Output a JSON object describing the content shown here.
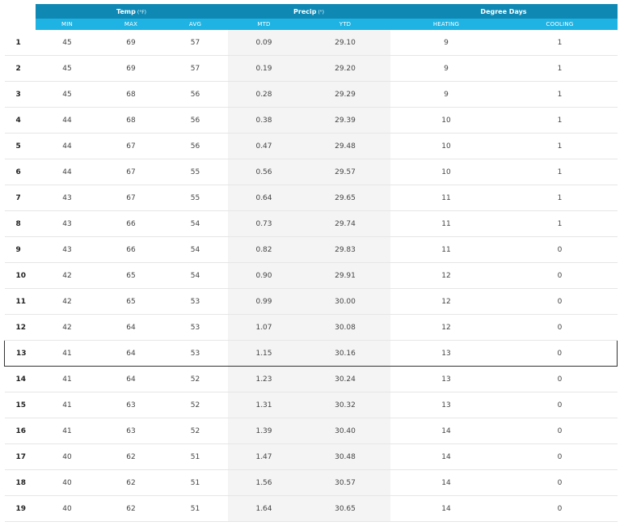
{
  "header": {
    "groups": [
      {
        "label": "Temp",
        "unit": "(°F)"
      },
      {
        "label": "Precip",
        "unit": "(\")"
      },
      {
        "label": "Degree Days",
        "unit": ""
      }
    ],
    "columns": [
      "MIN",
      "MAX",
      "AVG",
      "MTD",
      "YTD",
      "HEATING",
      "COOLING"
    ]
  },
  "selected_day": "13",
  "rows": [
    {
      "day": "1",
      "min": "45",
      "max": "69",
      "avg": "57",
      "mtd": "0.09",
      "ytd": "29.10",
      "heating": "9",
      "cooling": "1"
    },
    {
      "day": "2",
      "min": "45",
      "max": "69",
      "avg": "57",
      "mtd": "0.19",
      "ytd": "29.20",
      "heating": "9",
      "cooling": "1"
    },
    {
      "day": "3",
      "min": "45",
      "max": "68",
      "avg": "56",
      "mtd": "0.28",
      "ytd": "29.29",
      "heating": "9",
      "cooling": "1"
    },
    {
      "day": "4",
      "min": "44",
      "max": "68",
      "avg": "56",
      "mtd": "0.38",
      "ytd": "29.39",
      "heating": "10",
      "cooling": "1"
    },
    {
      "day": "5",
      "min": "44",
      "max": "67",
      "avg": "56",
      "mtd": "0.47",
      "ytd": "29.48",
      "heating": "10",
      "cooling": "1"
    },
    {
      "day": "6",
      "min": "44",
      "max": "67",
      "avg": "55",
      "mtd": "0.56",
      "ytd": "29.57",
      "heating": "10",
      "cooling": "1"
    },
    {
      "day": "7",
      "min": "43",
      "max": "67",
      "avg": "55",
      "mtd": "0.64",
      "ytd": "29.65",
      "heating": "11",
      "cooling": "1"
    },
    {
      "day": "8",
      "min": "43",
      "max": "66",
      "avg": "54",
      "mtd": "0.73",
      "ytd": "29.74",
      "heating": "11",
      "cooling": "1"
    },
    {
      "day": "9",
      "min": "43",
      "max": "66",
      "avg": "54",
      "mtd": "0.82",
      "ytd": "29.83",
      "heating": "11",
      "cooling": "0"
    },
    {
      "day": "10",
      "min": "42",
      "max": "65",
      "avg": "54",
      "mtd": "0.90",
      "ytd": "29.91",
      "heating": "12",
      "cooling": "0"
    },
    {
      "day": "11",
      "min": "42",
      "max": "65",
      "avg": "53",
      "mtd": "0.99",
      "ytd": "30.00",
      "heating": "12",
      "cooling": "0"
    },
    {
      "day": "12",
      "min": "42",
      "max": "64",
      "avg": "53",
      "mtd": "1.07",
      "ytd": "30.08",
      "heating": "12",
      "cooling": "0"
    },
    {
      "day": "13",
      "min": "41",
      "max": "64",
      "avg": "53",
      "mtd": "1.15",
      "ytd": "30.16",
      "heating": "13",
      "cooling": "0"
    },
    {
      "day": "14",
      "min": "41",
      "max": "64",
      "avg": "52",
      "mtd": "1.23",
      "ytd": "30.24",
      "heating": "13",
      "cooling": "0"
    },
    {
      "day": "15",
      "min": "41",
      "max": "63",
      "avg": "52",
      "mtd": "1.31",
      "ytd": "30.32",
      "heating": "13",
      "cooling": "0"
    },
    {
      "day": "16",
      "min": "41",
      "max": "63",
      "avg": "52",
      "mtd": "1.39",
      "ytd": "30.40",
      "heating": "14",
      "cooling": "0"
    },
    {
      "day": "17",
      "min": "40",
      "max": "62",
      "avg": "51",
      "mtd": "1.47",
      "ytd": "30.48",
      "heating": "14",
      "cooling": "0"
    },
    {
      "day": "18",
      "min": "40",
      "max": "62",
      "avg": "51",
      "mtd": "1.56",
      "ytd": "30.57",
      "heating": "14",
      "cooling": "0"
    },
    {
      "day": "19",
      "min": "40",
      "max": "62",
      "avg": "51",
      "mtd": "1.64",
      "ytd": "30.65",
      "heating": "14",
      "cooling": "0"
    }
  ]
}
